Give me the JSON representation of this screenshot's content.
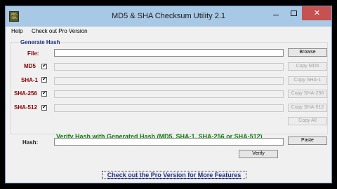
{
  "window": {
    "title": "MD5 & SHA Checksum Utility 2.1",
    "icon_text_1": "MD5",
    "icon_text_2": "SHA"
  },
  "menu": {
    "help": "Help",
    "pro": "Check out Pro Version"
  },
  "generate": {
    "group_title": "Generate Hash",
    "file_label": "File:",
    "file_value": "",
    "browse_label": "Browse",
    "rows": [
      {
        "label": "MD5",
        "checked": true,
        "button": "Copy MD5"
      },
      {
        "label": "SHA-1",
        "checked": true,
        "button": "Copy SHA-1"
      },
      {
        "label": "SHA-256",
        "checked": true,
        "button": "Copy SHA-256"
      },
      {
        "label": "SHA-512",
        "checked": true,
        "button": "Copy SHA-512"
      }
    ],
    "copy_all_label": "Copy All"
  },
  "verify": {
    "title": "Verify Hash with Generated Hash (MD5, SHA-1, SHA-256 or SHA-512)",
    "hash_label": "Hash:",
    "hash_value": "",
    "paste_label": "Paste",
    "verify_label": "Verify"
  },
  "footer": {
    "pro_link": "Check out the Pro Version for More Features"
  },
  "colors": {
    "accent_red_label": "#8b0000",
    "verify_green": "#107c10",
    "group_title_blue": "#1a2f7a",
    "close_red": "#c75050"
  },
  "icons": {
    "minimize": "minimize-icon",
    "maximize": "maximize-icon",
    "close": "close-icon",
    "check": "checkmark-icon"
  },
  "glyphs": {
    "close": "✕",
    "check": "✔"
  }
}
